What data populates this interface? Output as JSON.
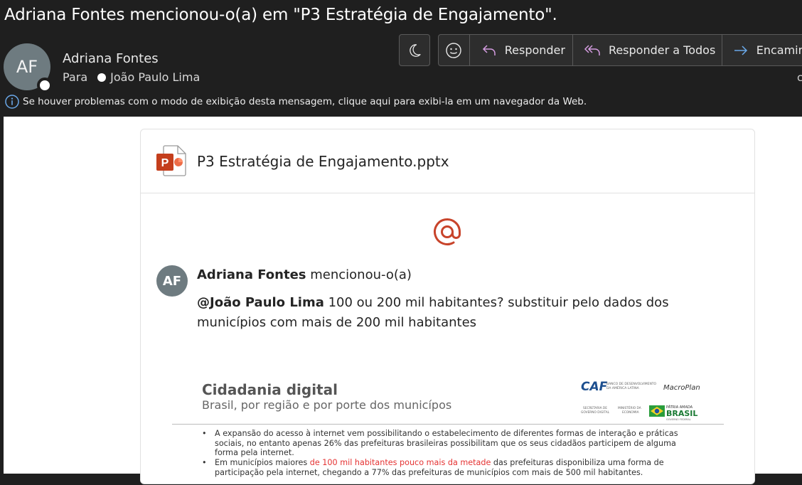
{
  "subject": "Adriana Fontes mencionou-o(a) em \"P3 Estratégia de Engajamento\".",
  "sender": {
    "initials": "AF",
    "name": "Adriana Fontes",
    "to_label": "Para",
    "recipient": "João Paulo Lima"
  },
  "right_edge_char": "c",
  "toolbar": {
    "reply": "Responder",
    "reply_all": "Responder a Todos",
    "forward": "Encamin"
  },
  "info_bar": "Se houver problemas com o modo de exibição desta mensagem, clique aqui para exibi-la em um navegador da Web.",
  "card": {
    "file_name": "P3 Estratégia de Engajamento.pptx",
    "mention": {
      "initials": "AF",
      "author": "Adriana Fontes",
      "action": "mencionou-o(a)",
      "tagged": "@João Paulo Lima",
      "comment": " 100 ou 200 mil habitantes? substituir pelo dados dos municípios com mais de 200 mil habitantes"
    },
    "slide": {
      "title": "Cidadania digital",
      "subtitle": "Brasil, por região e por porte dos municípos",
      "bullet1": "A expansão do acesso à internet vem possibilitando o estabelecimento de diferentes formas de interação e práticas sociais, no entanto apenas 26% das prefeituras brasileiras possibilitam que os seus cidadãos participem de alguma forma pela internet.",
      "bullet2_pre": "Em municípios maiores ",
      "bullet2_red": "de 100 mil habitantes pouco mais da metade",
      "bullet2_post": " das prefeituras disponibiliza uma forma de participação pela internet, chegando a 77% das prefeituras de municípios com mais de 500 mil habitantes.",
      "logo_caf": "CAF",
      "logo_caf_sub1": "BANCO DE DESENVOLVIMENTO",
      "logo_caf_sub2": "DA AMÉRICA LATINA",
      "logo_macroplan": "MacroPlan",
      "logo_sec1": "SECRETARIA DE",
      "logo_sec2": "GOVERNO DIGITAL",
      "logo_min1": "MINISTÉRIO DA",
      "logo_min2": "ECONOMIA",
      "logo_patria": "PÁTRIA AMADA",
      "logo_brasil": "BRASIL",
      "logo_gov": "GOVERNO FEDERAL"
    }
  }
}
